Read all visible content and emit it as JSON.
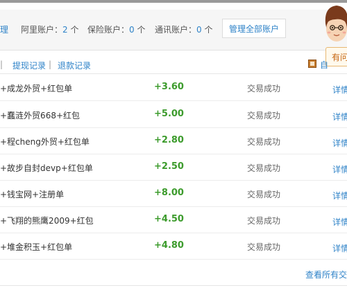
{
  "accounts": {
    "first_label": "理",
    "alipay": {
      "label": "阿里账户：",
      "count": "2",
      "unit": "个"
    },
    "insurance": {
      "label": "保险账户：",
      "count": "0",
      "unit": "个"
    },
    "telecom": {
      "label": "通讯账户：",
      "count": "0",
      "unit": "个"
    },
    "manage_label": "管理全部账户"
  },
  "assistant": {
    "bubble_text": "有问"
  },
  "tabs": {
    "separator": "|",
    "withdraw_label": "提现记录",
    "refund_label": "退款记录",
    "export_label": "自"
  },
  "rows": [
    {
      "name": "+成龙外贸+红包单",
      "amount": "+3.60",
      "status": "交易成功",
      "detail": "详情"
    },
    {
      "name": "+蠢涟外贸668+红包",
      "amount": "+5.00",
      "status": "交易成功",
      "detail": "详情"
    },
    {
      "name": "+程cheng外贸+红包单",
      "amount": "+2.80",
      "status": "交易成功",
      "detail": "详情"
    },
    {
      "name": "+故步自封devp+红包单",
      "amount": "+2.50",
      "status": "交易成功",
      "detail": "详情"
    },
    {
      "name": "+钱宝网+注册单",
      "amount": "+8.00",
      "status": "交易成功",
      "detail": "详情"
    },
    {
      "name": "+飞翔的熊鹰2009+红包",
      "amount": "+4.50",
      "status": "交易成功",
      "detail": "详情"
    },
    {
      "name": "+堆金积玉+红包单",
      "amount": "+4.80",
      "status": "交易成功",
      "detail": "详情"
    }
  ],
  "footer": {
    "view_all_label": "查看所有交易"
  }
}
